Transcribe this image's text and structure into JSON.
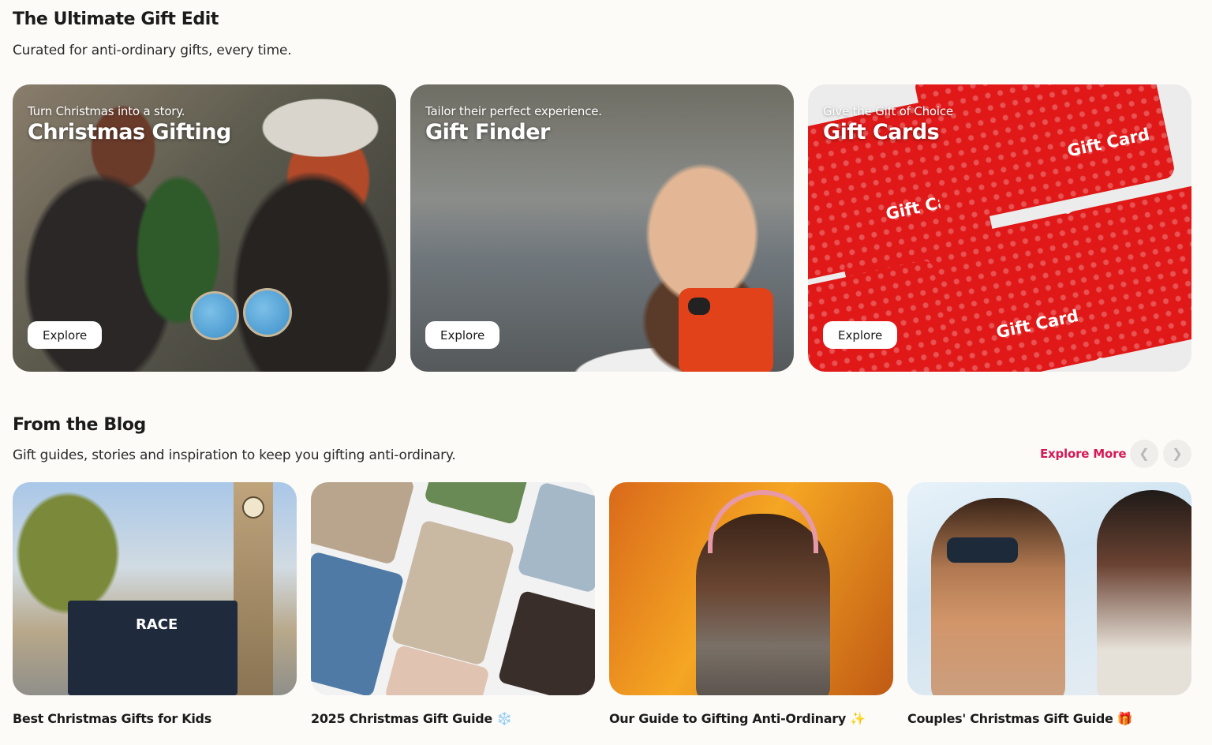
{
  "gift_edit": {
    "title": "The Ultimate Gift Edit",
    "subtitle": "Curated for anti-ordinary gifts, every time.",
    "cards": [
      {
        "tagline": "Turn Christmas into a story.",
        "title": "Christmas Gifting",
        "button": "Explore"
      },
      {
        "tagline": "Tailor their perfect experience.",
        "title": "Gift Finder",
        "button": "Explore"
      },
      {
        "tagline": "Give the Gift of Choice",
        "title": "Gift Cards",
        "button": "Explore"
      }
    ],
    "gift_card_label": "Gift Card",
    "box_text": "RACE"
  },
  "blog": {
    "title": "From the Blog",
    "subtitle": "Gift guides, stories and inspiration to keep you gifting anti-ordinary.",
    "explore_more": "Explore More",
    "prev_icon": "chevron-left-icon",
    "next_icon": "chevron-right-icon",
    "posts": [
      {
        "title": "Best Christmas Gifts for Kids",
        "emoji": ""
      },
      {
        "title": "2025 Christmas Gift Guide",
        "emoji": "❄️"
      },
      {
        "title": "Our Guide to Gifting Anti-Ordinary",
        "emoji": "✨"
      },
      {
        "title": "Couples' Christmas Gift Guide",
        "emoji": "🎁"
      }
    ]
  },
  "colors": {
    "accent": "#d41957",
    "giftcard_red": "#e01818",
    "background": "#fcfbf8"
  }
}
